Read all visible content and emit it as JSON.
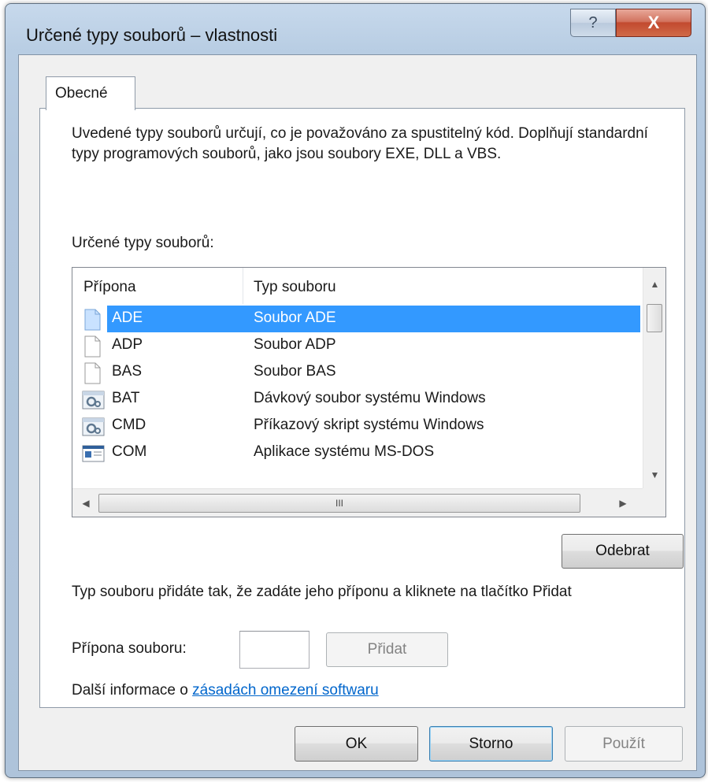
{
  "window": {
    "title": "Určené typy souborů – vlastnosti",
    "help_label": "?",
    "close_label": "X"
  },
  "tabs": [
    {
      "label": "Obecné",
      "selected": true
    }
  ],
  "description": "Uvedené typy souborů určují, co je považováno za spustitelný kód. Doplňují standardní typy programových souborů, jako jsou soubory EXE, DLL a VBS.",
  "list": {
    "label": "Určené typy souborů:",
    "columns": [
      "Přípona",
      "Typ souboru"
    ],
    "rows": [
      {
        "ext": "ADE",
        "type": "Soubor ADE",
        "icon": "blank-file-icon",
        "selected": true
      },
      {
        "ext": "ADP",
        "type": "Soubor ADP",
        "icon": "blank-file-icon"
      },
      {
        "ext": "BAS",
        "type": "Soubor BAS",
        "icon": "blank-file-icon"
      },
      {
        "ext": "BAT",
        "type": "Dávkový soubor systému Windows",
        "icon": "gear-script-icon"
      },
      {
        "ext": "CMD",
        "type": "Příkazový skript systému Windows",
        "icon": "gear-script-icon"
      },
      {
        "ext": "COM",
        "type": "Aplikace systému MS-DOS",
        "icon": "dos-app-icon"
      }
    ],
    "hscroll_grip": "III"
  },
  "remove_button": "Odebrat",
  "hint": "Typ souboru přidáte tak, že zadáte jeho příponu a kliknete na tlačítko Přidat",
  "extension": {
    "label": "Přípona souboru:",
    "value": "",
    "add_button": "Přidat"
  },
  "more_info": {
    "prefix": "Další informace o",
    "link": "zásadách omezení softwaru"
  },
  "footer": {
    "ok": "OK",
    "cancel": "Storno",
    "apply": "Použít"
  },
  "colors": {
    "selection": "#3399ff",
    "link": "#0066cc",
    "close_button": "#c24a2f"
  }
}
